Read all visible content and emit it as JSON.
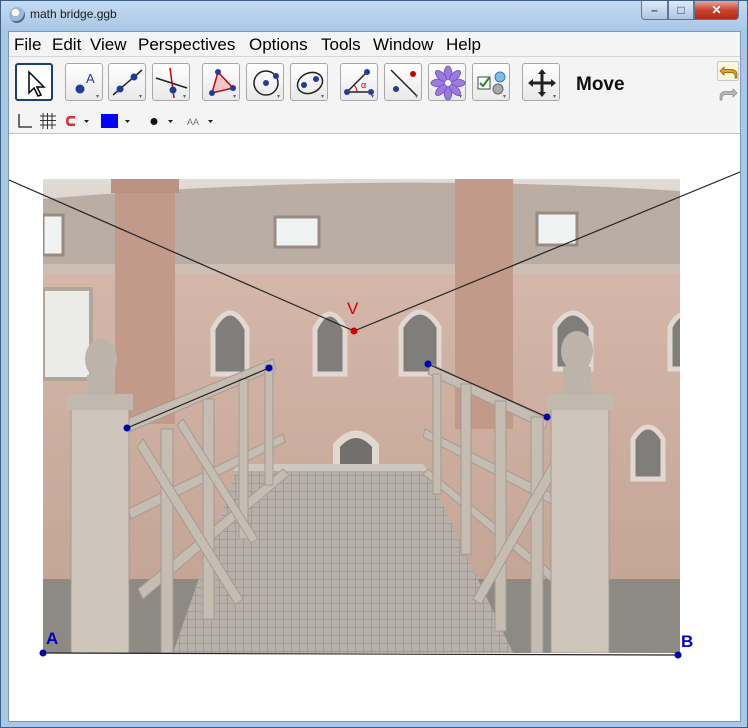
{
  "window": {
    "title": "math bridge.ggb",
    "controls": [
      "–",
      "□",
      "✕"
    ]
  },
  "menu": [
    "File",
    "Edit",
    "View",
    "Perspectives",
    "Options",
    "Tools",
    "Window",
    "Help"
  ],
  "toolbar": {
    "tools": [
      {
        "name": "move-tool-icon"
      },
      {
        "name": "point-tool-icon"
      },
      {
        "name": "line-tool-icon"
      },
      {
        "name": "perpendicular-line-tool-icon"
      },
      {
        "name": "polygon-tool-icon"
      },
      {
        "name": "circle-tool-icon"
      },
      {
        "name": "conic-tool-icon"
      },
      {
        "name": "angle-tool-icon"
      },
      {
        "name": "reflect-tool-icon"
      },
      {
        "name": "slider-tool-icon"
      },
      {
        "name": "checkbox-tool-icon"
      },
      {
        "name": "move-graphics-view-tool-icon"
      }
    ],
    "active_tool_label": "Move"
  },
  "stylebar": {
    "color": "#0000ff"
  },
  "graphics": {
    "points": [
      {
        "label": "V",
        "color": "#d40000"
      },
      {
        "label": "A",
        "color": "#0000cc"
      },
      {
        "label": "B",
        "color": "#0000cc"
      }
    ]
  },
  "colors": {
    "point_blue": "#0000aa",
    "point_red": "#d40000",
    "line": "#222222"
  }
}
